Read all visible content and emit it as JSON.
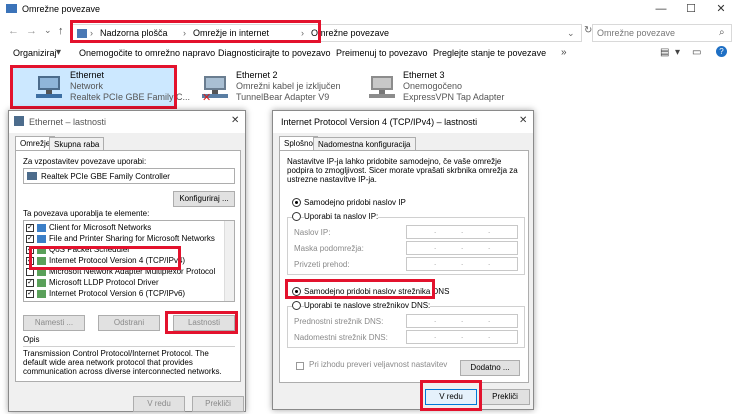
{
  "window": {
    "title": "Omrežne povezave",
    "controls": {
      "minimize": "—",
      "maximize": "☐",
      "close": "✕"
    }
  },
  "address": {
    "crumbs": [
      "Nadzorna plošča",
      "Omrežje in internet",
      "Omrežne povezave"
    ],
    "search_placeholder": "Omrežne povezave"
  },
  "toolbar": {
    "organize": "Organiziraj",
    "disable": "Onemogočite to omrežno napravo",
    "diagnose": "Diagnosticirajte to povezavo",
    "rename": "Preimenuj to povezavo",
    "status": "Preglejte stanje te povezave"
  },
  "connections": [
    {
      "name": "Ethernet",
      "status": "Network",
      "adapter": "Realtek PCIe GBE Family C..."
    },
    {
      "name": "Ethernet 2",
      "status": "Omrežni kabel je izključen",
      "adapter": "TunnelBear Adapter V9"
    },
    {
      "name": "Ethernet 3",
      "status": "Onemogočeno",
      "adapter": "ExpressVPN Tap Adapter"
    }
  ],
  "props": {
    "title": "Ethernet – lastnosti",
    "tabs": [
      "Omrežje",
      "Skupna raba"
    ],
    "connect_using": "Za vzpostavitev povezave uporabi:",
    "adapter": "Realtek PCIe GBE Family Controller",
    "configure": "Konfiguriraj ...",
    "items_label": "Ta povezava uporablja te elemente:",
    "items": [
      "Client for Microsoft Networks",
      "File and Printer Sharing for Microsoft Networks",
      "QoS Packet Scheduler",
      "Internet Protocol Version 4 (TCP/IPv4)",
      "Microsoft Network Adapter Multiplexor Protocol",
      "Microsoft LLDP Protocol Driver",
      "Internet Protocol Version 6 (TCP/IPv6)"
    ],
    "install": "Namesti ...",
    "uninstall": "Odstrani",
    "properties": "Lastnosti",
    "desc_title": "Opis",
    "desc": "Transmission Control Protocol/Internet Protocol. The default wide area network protocol that provides communication across diverse interconnected networks.",
    "ok": "V redu",
    "cancel": "Prekliči"
  },
  "ipv4": {
    "title": "Internet Protocol Version 4 (TCP/IPv4) – lastnosti",
    "tabs": [
      "Splošno",
      "Nadomestna konfiguracija"
    ],
    "intro": "Nastavitve IP-ja lahko pridobite samodejno, če vaše omrežje podpira to zmogljivost. Sicer morate vprašati skrbnika omrežja za ustrezne nastavitve IP-ja.",
    "auto_ip": "Samodejno pridobi naslov IP",
    "manual_ip": "Uporabi ta naslov IP:",
    "ip_label": "Naslov IP:",
    "mask_label": "Maska podomrežja:",
    "gateway_label": "Privzeti prehod:",
    "auto_dns": "Samodejno pridobi naslov strežnika DNS",
    "manual_dns": "Uporabi te naslove strežnikov DNS:",
    "pref_dns": "Prednostni strežnik DNS:",
    "alt_dns": "Nadomestni strežnik DNS:",
    "validate": "Pri izhodu preveri veljavnost nastavitev",
    "advanced": "Dodatno ...",
    "ok": "V redu",
    "cancel": "Prekliči",
    "ip_dot": "."
  },
  "colors": {
    "highlight": "#e3122d",
    "accent": "#0078d7"
  }
}
